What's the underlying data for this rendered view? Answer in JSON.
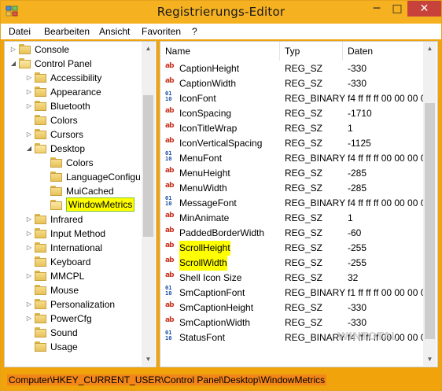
{
  "window": {
    "title": "Registrierungs-Editor"
  },
  "menu": [
    "Datei",
    "Bearbeiten",
    "Ansicht",
    "Favoriten",
    "?"
  ],
  "tree": [
    {
      "label": "Console",
      "level": 1,
      "arrow": "collapsed"
    },
    {
      "label": "Control Panel",
      "level": 1,
      "arrow": "expanded"
    },
    {
      "label": "Accessibility",
      "level": 2,
      "arrow": "collapsed"
    },
    {
      "label": "Appearance",
      "level": 2,
      "arrow": "collapsed"
    },
    {
      "label": "Bluetooth",
      "level": 2,
      "arrow": "collapsed"
    },
    {
      "label": "Colors",
      "level": 2,
      "arrow": "none"
    },
    {
      "label": "Cursors",
      "level": 2,
      "arrow": "collapsed"
    },
    {
      "label": "Desktop",
      "level": 2,
      "arrow": "expanded"
    },
    {
      "label": "Colors",
      "level": 3,
      "arrow": "none"
    },
    {
      "label": "LanguageConfigu",
      "level": 3,
      "arrow": "none"
    },
    {
      "label": "MuiCached",
      "level": 3,
      "arrow": "none"
    },
    {
      "label": "WindowMetrics",
      "level": 3,
      "arrow": "none",
      "selected": true
    },
    {
      "label": "Infrared",
      "level": 2,
      "arrow": "collapsed"
    },
    {
      "label": "Input Method",
      "level": 2,
      "arrow": "collapsed"
    },
    {
      "label": "International",
      "level": 2,
      "arrow": "collapsed"
    },
    {
      "label": "Keyboard",
      "level": 2,
      "arrow": "none"
    },
    {
      "label": "MMCPL",
      "level": 2,
      "arrow": "collapsed"
    },
    {
      "label": "Mouse",
      "level": 2,
      "arrow": "none"
    },
    {
      "label": "Personalization",
      "level": 2,
      "arrow": "collapsed"
    },
    {
      "label": "PowerCfg",
      "level": 2,
      "arrow": "collapsed"
    },
    {
      "label": "Sound",
      "level": 2,
      "arrow": "none"
    },
    {
      "label": "Usage",
      "level": 2,
      "arrow": "none"
    }
  ],
  "columns": {
    "name": "Name",
    "type": "Typ",
    "data": "Daten"
  },
  "values": [
    {
      "name": "CaptionHeight",
      "type": "REG_SZ",
      "data": "-330",
      "icon": "string"
    },
    {
      "name": "CaptionWidth",
      "type": "REG_SZ",
      "data": "-330",
      "icon": "string"
    },
    {
      "name": "IconFont",
      "type": "REG_BINARY",
      "data": "f4 ff ff ff 00 00 00 0",
      "icon": "binary"
    },
    {
      "name": "IconSpacing",
      "type": "REG_SZ",
      "data": "-1710",
      "icon": "string"
    },
    {
      "name": "IconTitleWrap",
      "type": "REG_SZ",
      "data": "1",
      "icon": "string"
    },
    {
      "name": "IconVerticalSpacing",
      "type": "REG_SZ",
      "data": "-1125",
      "icon": "string"
    },
    {
      "name": "MenuFont",
      "type": "REG_BINARY",
      "data": "f4 ff ff ff 00 00 00 0",
      "icon": "binary"
    },
    {
      "name": "MenuHeight",
      "type": "REG_SZ",
      "data": "-285",
      "icon": "string"
    },
    {
      "name": "MenuWidth",
      "type": "REG_SZ",
      "data": "-285",
      "icon": "string"
    },
    {
      "name": "MessageFont",
      "type": "REG_BINARY",
      "data": "f4 ff ff ff 00 00 00 0",
      "icon": "binary"
    },
    {
      "name": "MinAnimate",
      "type": "REG_SZ",
      "data": "1",
      "icon": "string"
    },
    {
      "name": "PaddedBorderWidth",
      "type": "REG_SZ",
      "data": "-60",
      "icon": "string"
    },
    {
      "name": "ScrollHeight",
      "type": "REG_SZ",
      "data": "-255",
      "icon": "string",
      "highlighted": true
    },
    {
      "name": "ScrollWidth",
      "type": "REG_SZ",
      "data": "-255",
      "icon": "string",
      "highlighted": true
    },
    {
      "name": "Shell Icon Size",
      "type": "REG_SZ",
      "data": "32",
      "icon": "string"
    },
    {
      "name": "SmCaptionFont",
      "type": "REG_BINARY",
      "data": "f1 ff ff ff 00 00 00 0",
      "icon": "binary"
    },
    {
      "name": "SmCaptionHeight",
      "type": "REG_SZ",
      "data": "-330",
      "icon": "string"
    },
    {
      "name": "SmCaptionWidth",
      "type": "REG_SZ",
      "data": "-330",
      "icon": "string"
    },
    {
      "name": "StatusFont",
      "type": "REG_BINARY",
      "data": "f4 ff ff ff 00 00 00 0",
      "icon": "binary"
    }
  ],
  "status": {
    "path": "Computer\\HKEY_CURRENT_USER\\Control Panel\\Desktop\\WindowMetrics"
  },
  "watermark": "WINTOTAL",
  "colors": {
    "frame": "#f0a30a",
    "titlebar": "#f5b120",
    "close": "#c7423a",
    "highlight": "#ffff00"
  },
  "icons": {
    "app": "registry-editor-icon",
    "string_value": "string-value-icon",
    "binary_value": "binary-value-icon",
    "folder": "folder-icon"
  }
}
